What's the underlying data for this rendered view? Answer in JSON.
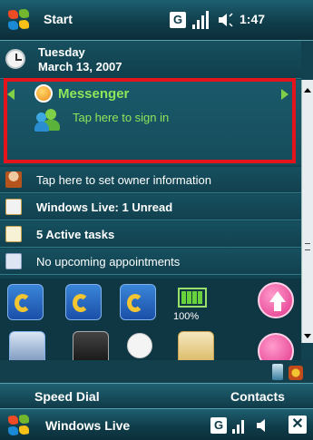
{
  "top_bar": {
    "title": "Start",
    "g_label": "G",
    "time": "1:47"
  },
  "date": {
    "weekday": "Tuesday",
    "full": "March 13, 2007"
  },
  "messenger": {
    "title": "Messenger",
    "subtitle": "Tap here to sign in"
  },
  "today_items": [
    {
      "text": "Tap here to set owner information",
      "bold": false,
      "icon": "owner-icon"
    },
    {
      "text": "Windows Live: 1 Unread",
      "bold": true,
      "icon": "mail-icon"
    },
    {
      "text": "5 Active tasks",
      "bold": true,
      "icon": "tasks-icon"
    },
    {
      "text": "No upcoming appointments",
      "bold": false,
      "icon": "calendar-icon"
    }
  ],
  "battery": {
    "label": "100%",
    "level": 1.0
  },
  "softkeys": {
    "left": "Speed Dial",
    "right": "Contacts"
  },
  "bottom_bar": {
    "title": "Windows Live",
    "g_label": "G",
    "close_label": "✕"
  },
  "colors": {
    "accent_green": "#8ee65a",
    "highlight_red": "#e3141b",
    "background": "#12414f"
  }
}
